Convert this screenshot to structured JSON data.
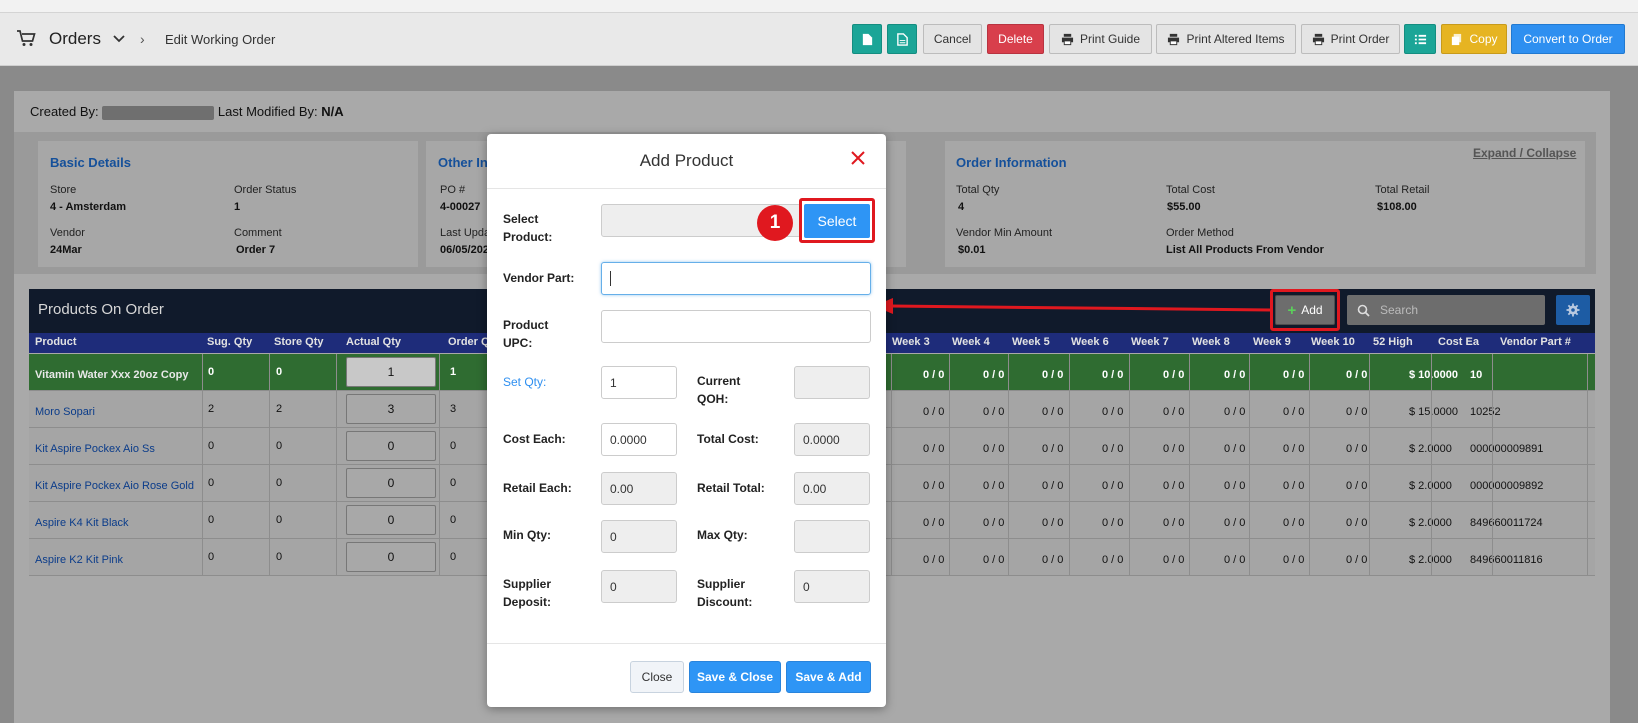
{
  "header": {
    "title": "Orders",
    "breadcrumb": "Edit Working Order",
    "buttons": {
      "cancel": "Cancel",
      "delete": "Delete",
      "print_guide": "Print Guide",
      "print_altered": "Print Altered Items",
      "print_order": "Print Order",
      "copy": "Copy",
      "convert": "Convert to Order"
    }
  },
  "meta": {
    "created_by_label": "Created By:",
    "last_modified_label": "Last Modified By:",
    "last_modified_value": "N/A"
  },
  "basic_details": {
    "title": "Basic Details",
    "store_label": "Store",
    "store_value": "4 - Amsterdam",
    "status_label": "Order Status",
    "status_value": "1",
    "vendor_label": "Vendor",
    "vendor_value": "24Mar",
    "comment_label": "Comment",
    "comment_value": "Order 7"
  },
  "other_info": {
    "title": "Other In",
    "po_label": "PO #",
    "po_value": "4-00027",
    "last_upd_label": "Last Upda",
    "last_upd_value": "06/05/202"
  },
  "order_information": {
    "title": "Order Information",
    "expand_link": "Expand / Collapse",
    "total_qty_label": "Total Qty",
    "total_qty_value": "4",
    "total_cost_label": "Total Cost",
    "total_cost_value": "$55.00",
    "total_retail_label": "Total Retail",
    "total_retail_value": "$108.00",
    "vendor_min_label": "Vendor Min Amount",
    "vendor_min_value": "$0.01",
    "method_label": "Order Method",
    "method_value": "List All Products From Vendor"
  },
  "products": {
    "title": "Products On Order",
    "add_label": "Add",
    "search_placeholder": "Search",
    "columns_left": [
      "Product",
      "Sug. Qty",
      "Store Qty",
      "Actual Qty",
      "Order Q"
    ],
    "columns_right": [
      "Week 3",
      "Week 4",
      "Week 5",
      "Week 6",
      "Week 7",
      "Week 8",
      "Week 9",
      "Week 10",
      "52 High",
      "Cost Ea",
      "Vendor Part #"
    ],
    "rows": [
      {
        "name": "Vitamin Water Xxx 20oz Copy",
        "sug": "0",
        "store": "0",
        "actual": "1",
        "order": "1",
        "weeks": [
          "0 / 0",
          "0 / 0",
          "0 / 0",
          "0 / 0",
          "0 / 0",
          "0 / 0",
          "0 / 0",
          "0 / 0",
          "0 / 0"
        ],
        "cost": "$ 10.0000",
        "part": "10"
      },
      {
        "name": "Moro Sopari",
        "sug": "2",
        "store": "2",
        "actual": "3",
        "order": "3",
        "weeks": [
          "0 / 0",
          "0 / 0",
          "0 / 0",
          "0 / 0",
          "0 / 0",
          "0 / 0",
          "0 / 0",
          "0 / 0",
          "0 / 0"
        ],
        "cost": "$ 15.0000",
        "part": "10252"
      },
      {
        "name": "Kit Aspire Pockex Aio Ss",
        "sug": "0",
        "store": "0",
        "actual": "0",
        "order": "0",
        "weeks": [
          "0 / 0",
          "0 / 0",
          "0 / 0",
          "0 / 0",
          "0 / 0",
          "0 / 0",
          "0 / 0",
          "0 / 0",
          "0 / 0"
        ],
        "cost": "$ 2.0000",
        "part": "000000009891"
      },
      {
        "name": "Kit Aspire Pockex Aio Rose Gold",
        "sug": "0",
        "store": "0",
        "actual": "0",
        "order": "0",
        "weeks": [
          "0 / 0",
          "0 / 0",
          "0 / 0",
          "0 / 0",
          "0 / 0",
          "0 / 0",
          "0 / 0",
          "0 / 0",
          "0 / 0"
        ],
        "cost": "$ 2.0000",
        "part": "000000009892"
      },
      {
        "name": "Aspire K4 Kit Black",
        "sug": "0",
        "store": "0",
        "actual": "0",
        "order": "0",
        "weeks": [
          "0 / 0",
          "0 / 0",
          "0 / 0",
          "0 / 0",
          "0 / 0",
          "0 / 0",
          "0 / 0",
          "0 / 0",
          "0 / 0"
        ],
        "cost": "$ 2.0000",
        "part": "849660011724"
      },
      {
        "name": "Aspire K2 Kit Pink",
        "sug": "0",
        "store": "0",
        "actual": "0",
        "order": "0",
        "weeks": [
          "0 / 0",
          "0 / 0",
          "0 / 0",
          "0 / 0",
          "0 / 0",
          "0 / 0",
          "0 / 0",
          "0 / 0",
          "0 / 0"
        ],
        "cost": "$ 2.0000",
        "part": "849660011816"
      }
    ]
  },
  "modal": {
    "title": "Add Product",
    "select_product_label": "Select\nProduct:",
    "select_button": "Select",
    "step_number": "1",
    "vendor_part_label": "Vendor Part:",
    "vendor_part_value": "",
    "upc_label": "Product\nUPC:",
    "upc_value": "",
    "set_qty_label": "Set Qty:",
    "set_qty_value": "1",
    "qoh_label": "Current\nQOH:",
    "qoh_value": "",
    "cost_each_label": "Cost Each:",
    "cost_each_value": "0.0000",
    "total_cost_label": "Total Cost:",
    "total_cost_value": "0.0000",
    "retail_each_label": "Retail Each:",
    "retail_each_value": "0.00",
    "retail_total_label": "Retail Total:",
    "retail_total_value": "0.00",
    "min_qty_label": "Min Qty:",
    "min_qty_value": "0",
    "max_qty_label": "Max Qty:",
    "max_qty_value": "",
    "deposit_label": "Supplier\nDeposit:",
    "deposit_value": "0",
    "discount_label": "Supplier\nDiscount:",
    "discount_value": "0",
    "close_button": "Close",
    "save_close_button": "Save & Close",
    "save_add_button": "Save & Add"
  },
  "colors": {
    "accent_blue": "#2e95f5",
    "highlight_red": "#e0181f",
    "teal": "#1ba597",
    "danger": "#d83f4c",
    "warning": "#e6b422"
  }
}
